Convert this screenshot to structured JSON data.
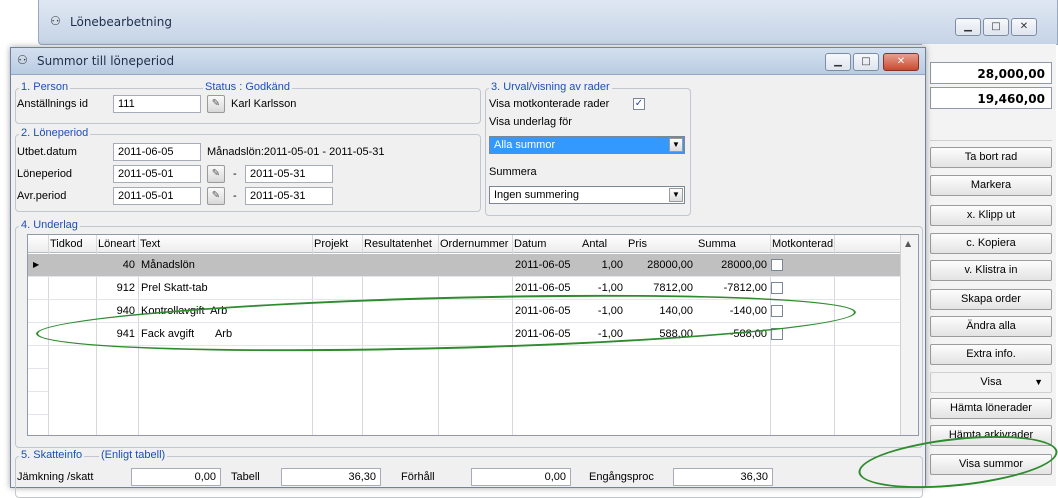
{
  "background_window": {
    "title": "Lönebearbetning",
    "totals": [
      "28,000,00",
      "19,460,00"
    ],
    "side_buttons": [
      {
        "label": "Ta bort rad"
      },
      {
        "label": "Markera"
      },
      {
        "label": "x. Klipp ut"
      },
      {
        "label": "c. Kopiera"
      },
      {
        "label": "v. Klistra in"
      },
      {
        "label": "Skapa order"
      },
      {
        "label": "Ändra alla"
      },
      {
        "label": "Extra info."
      },
      {
        "label": "Visa"
      },
      {
        "label": "Hämta lönerader"
      },
      {
        "label": "Hämta arkivrader"
      },
      {
        "label": "Visa summor"
      }
    ]
  },
  "dialog": {
    "title": "Summor till löneperiod",
    "person": {
      "group_label": "1. Person",
      "status_label": "Status : Godkänd",
      "anst_label": "Anställnings id",
      "anst_value": "111",
      "name": "Karl Karlsson"
    },
    "period": {
      "group_label": "2. Löneperiod",
      "utbet_label": "Utbet.datum",
      "utbet_value": "2011-06-05",
      "manadslon_text": "Månadslön:2011-05-01 - 2011-05-31",
      "loneperiod_label": "Löneperiod",
      "loneperiod_from": "2011-05-01",
      "loneperiod_to": "2011-05-31",
      "avr_label": "Avr.period",
      "avr_from": "2011-05-01",
      "avr_to": "2011-05-31",
      "dash": "-"
    },
    "urval": {
      "group_label": "3. Urval/visning av rader",
      "motkonterade_label": "Visa motkonterade rader",
      "motkonterade_checked": "✓",
      "underlag_label": "Visa underlag för",
      "underlag_value": "Alla summor",
      "summera_label": "Summera",
      "summera_value": "Ingen summering"
    },
    "underlag": {
      "group_label": "4. Underlag",
      "columns": [
        "Tidkod",
        "Löneart",
        "Text",
        "Projekt",
        "Resultatenhet",
        "Ordernummer",
        "Datum",
        "Antal",
        "Pris",
        "Summa",
        "Motkonterad"
      ],
      "rows": [
        {
          "loneart": "40",
          "text": "Månadslön",
          "projekt": "",
          "datum": "2011-06-05",
          "antal": "1,00",
          "pris": "28000,00",
          "summa": "28000,00"
        },
        {
          "loneart": "912",
          "text": "Prel Skatt-tab",
          "projekt": "",
          "datum": "2011-06-05",
          "antal": "-1,00",
          "pris": "7812,00",
          "summa": "-7812,00"
        },
        {
          "loneart": "940",
          "text": "Kontrollavgift  Arb",
          "projekt": "",
          "datum": "2011-06-05",
          "antal": "-1,00",
          "pris": "140,00",
          "summa": "-140,00"
        },
        {
          "loneart": "941",
          "text": "Fack avgift       Arb",
          "projekt": "",
          "datum": "2011-06-05",
          "antal": "-1,00",
          "pris": "588,00",
          "summa": "-588,00"
        }
      ]
    },
    "skatteinfo": {
      "group_label": "5. Skatteinfo",
      "sub_label": "(Enligt tabell)",
      "jamkning_label": "Jämkning /skatt",
      "jamkning_value": "0,00",
      "tabell_label": "Tabell",
      "tabell_value": "36,30",
      "forhall_label": "Förhåll",
      "forhall_value": "0,00",
      "engangs_label": "Engångsproc",
      "engangs_value": "36,30"
    }
  }
}
